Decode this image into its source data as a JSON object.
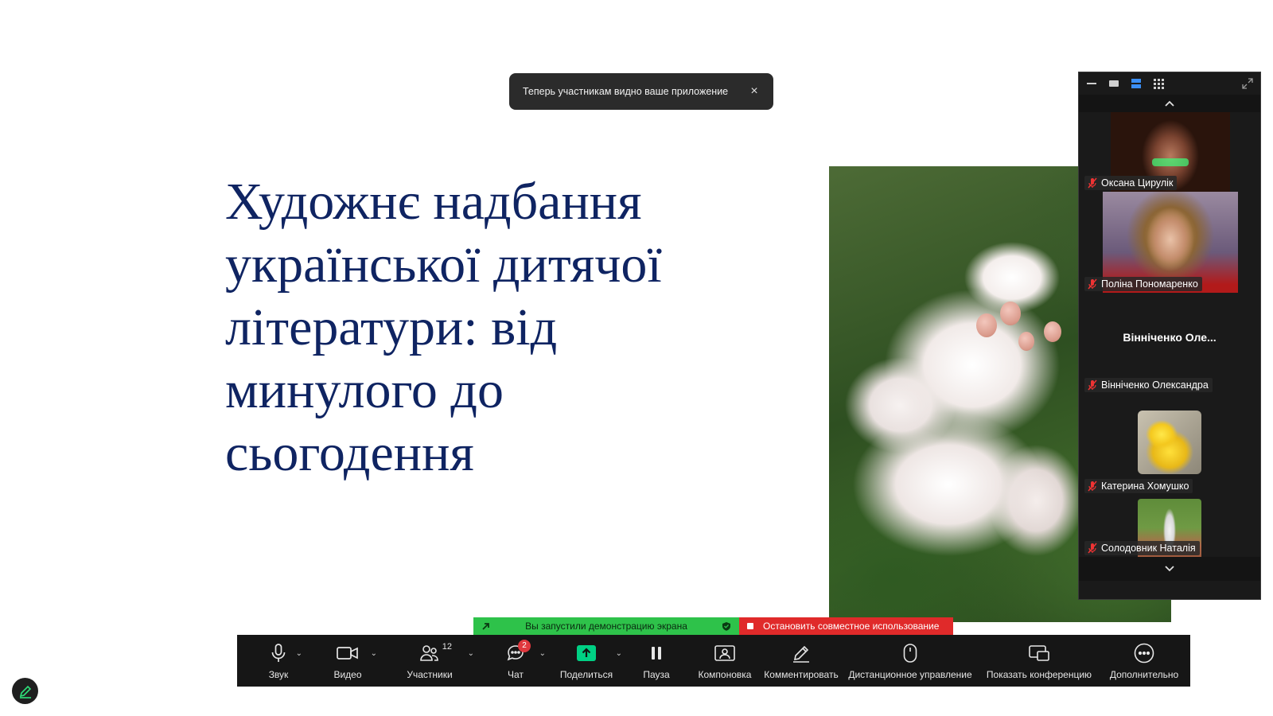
{
  "slide": {
    "title_lines": [
      "Художнє надбання",
      "української дитячої",
      "літератури: від",
      "минулого до",
      "сьогодення"
    ]
  },
  "toast": {
    "message": "Теперь участникам видно ваше приложение",
    "close_glyph": "×"
  },
  "gallery": {
    "participants": [
      {
        "name": "Оксана Цирулік",
        "video": true
      },
      {
        "name": "Поліна Пономаренко",
        "video": true
      },
      {
        "name": "Вінніченко Олександра",
        "display_name": "Вінніченко  Оле...",
        "video": false
      },
      {
        "name": "Катерина Хомушко",
        "video": true
      },
      {
        "name": "Солодовник Наталія",
        "video": true
      }
    ]
  },
  "share_status": {
    "active_text": "Вы запустили демонстрацию экрана",
    "stop_text": "Остановить совместное использование"
  },
  "toolbar": {
    "audio": "Звук",
    "video": "Видео",
    "participants": "Участники",
    "participants_count": "12",
    "chat": "Чат",
    "chat_unread": "2",
    "share": "Поделиться",
    "pause": "Пауза",
    "layout": "Компоновка",
    "annotate": "Комментировать",
    "remote_control": "Дистанционное управление",
    "show_conference": "Показать конференцию",
    "more": "Дополнительно"
  },
  "colors": {
    "slide_title": "#0f2462",
    "share_green": "#2ec24a",
    "share_red": "#e02a2a",
    "toolbar_bg": "#161616",
    "share_icon": "#00d084"
  }
}
